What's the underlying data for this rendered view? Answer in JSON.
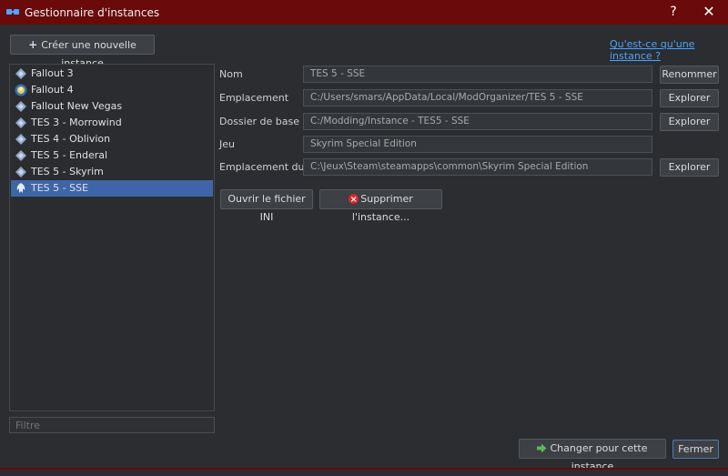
{
  "window": {
    "title": "Gestionnaire d'instances",
    "help_label": "?",
    "close_label": "✕",
    "titlebar_color": "#6a0a0a"
  },
  "toolbar": {
    "create_icon": "+",
    "create_label": "Créer une nouvelle instance",
    "whatis_link": "Qu'est-ce qu'une instance ?"
  },
  "instances": [
    {
      "label": "Fallout 3",
      "icon": "game-diamond-icon"
    },
    {
      "label": "Fallout 4",
      "icon": "vault-boy-icon"
    },
    {
      "label": "Fallout New Vegas",
      "icon": "game-diamond-icon"
    },
    {
      "label": "TES 3 - Morrowind",
      "icon": "game-diamond-icon"
    },
    {
      "label": "TES 4 - Oblivion",
      "icon": "game-diamond-icon"
    },
    {
      "label": "TES 5 - Enderal",
      "icon": "game-diamond-icon"
    },
    {
      "label": "TES 5 - Skyrim",
      "icon": "game-diamond-icon"
    },
    {
      "label": "TES 5 - SSE",
      "icon": "skyrim-dragon-icon",
      "selected": true
    }
  ],
  "filter": {
    "placeholder": "Filtre"
  },
  "details": {
    "name_label": "Nom",
    "name_value": "TES 5 - SSE",
    "rename_button": "Renommer",
    "location_label": "Emplacement",
    "location_value": "C:/Users/smars/AppData/Local/ModOrganizer/TES 5 - SSE",
    "location_button": "Explorer",
    "base_label": "Dossier de base",
    "base_value": "C:/Modding/Instance - TES5 - SSE",
    "base_button": "Explorer",
    "game_label": "Jeu",
    "game_value": "Skyrim Special Edition",
    "gamepath_label": "Emplacement du jeu",
    "gamepath_value": "C:\\Jeux\\Steam\\steamapps\\common\\Skyrim Special Edition",
    "gamepath_button": "Explorer"
  },
  "actions": {
    "open_ini": "Ouvrir le fichier INI",
    "delete_instance": "Supprimer l'instance..."
  },
  "footer": {
    "switch_label": "Changer pour cette instance",
    "close_label": "Fermer"
  },
  "colors": {
    "accent": "#3f65a9",
    "link": "#4aa3ff",
    "delete": "#d6262a",
    "switch_arrow": "#5cb85c"
  }
}
